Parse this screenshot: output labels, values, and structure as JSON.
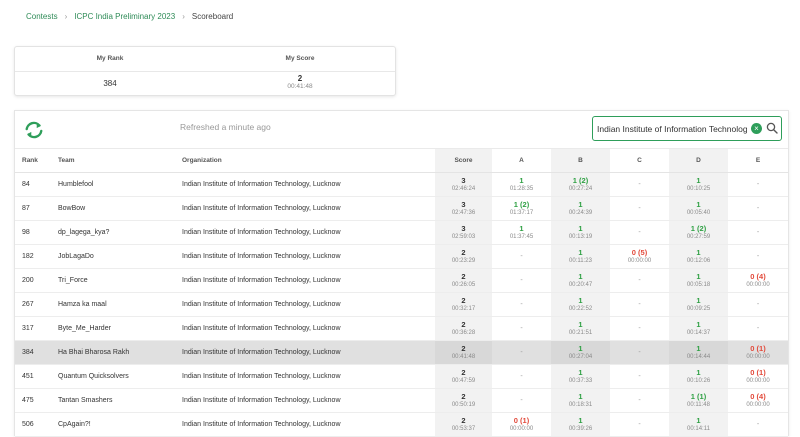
{
  "breadcrumb": {
    "items": [
      "Contests",
      "ICPC India Preliminary 2023"
    ],
    "current": "Scoreboard",
    "separator": "›"
  },
  "my_card": {
    "rank_label": "My Rank",
    "score_label": "My Score",
    "rank_value": "384",
    "score_value": "2",
    "score_time": "00:41:48"
  },
  "toolbar": {
    "refreshed_text": "Refreshed a minute ago",
    "search_value": "Indian Institute of Information Technology",
    "clear_label": "×"
  },
  "table": {
    "columns": {
      "rank": "Rank",
      "team": "Team",
      "org": "Organization",
      "score": "Score",
      "problems": [
        "A",
        "B",
        "C",
        "D",
        "E"
      ]
    },
    "highlight_rank": "384",
    "rows": [
      {
        "rank": "84",
        "team": "Humblefool",
        "org": "Indian Institute of Information Technology, Lucknow",
        "score": "3",
        "time": "02:46:24",
        "p": [
          {
            "s": "1",
            "t": "01:28:35",
            "st": "ok"
          },
          {
            "s": "1 (2)",
            "t": "00:27:24",
            "st": "ok"
          },
          {
            "s": "-",
            "t": "",
            "st": "none"
          },
          {
            "s": "1",
            "t": "00:10:25",
            "st": "ok"
          },
          {
            "s": "-",
            "t": "",
            "st": "none"
          }
        ]
      },
      {
        "rank": "87",
        "team": "BowBow",
        "org": "Indian Institute of Information Technology, Lucknow",
        "score": "3",
        "time": "02:47:36",
        "p": [
          {
            "s": "1 (2)",
            "t": "01:37:17",
            "st": "ok"
          },
          {
            "s": "1",
            "t": "00:24:39",
            "st": "ok"
          },
          {
            "s": "-",
            "t": "",
            "st": "none"
          },
          {
            "s": "1",
            "t": "00:05:40",
            "st": "ok"
          },
          {
            "s": "-",
            "t": "",
            "st": "none"
          }
        ]
      },
      {
        "rank": "98",
        "team": "dp_lagega_kya?",
        "org": "Indian Institute of Information Technology, Lucknow",
        "score": "3",
        "time": "02:59:03",
        "p": [
          {
            "s": "1",
            "t": "01:37:45",
            "st": "ok"
          },
          {
            "s": "1",
            "t": "00:13:19",
            "st": "ok"
          },
          {
            "s": "-",
            "t": "",
            "st": "none"
          },
          {
            "s": "1 (2)",
            "t": "00:27:59",
            "st": "ok"
          },
          {
            "s": "-",
            "t": "",
            "st": "none"
          }
        ]
      },
      {
        "rank": "182",
        "team": "JobLagaDo",
        "org": "Indian Institute of Information Technology, Lucknow",
        "score": "2",
        "time": "00:23:29",
        "p": [
          {
            "s": "-",
            "t": "",
            "st": "none"
          },
          {
            "s": "1",
            "t": "00:11:23",
            "st": "ok"
          },
          {
            "s": "0 (5)",
            "t": "00:00:00",
            "st": "fail"
          },
          {
            "s": "1",
            "t": "00:12:06",
            "st": "ok"
          },
          {
            "s": "-",
            "t": "",
            "st": "none"
          }
        ]
      },
      {
        "rank": "200",
        "team": "Tri_Force",
        "org": "Indian Institute of Information Technology, Lucknow",
        "score": "2",
        "time": "00:26:05",
        "p": [
          {
            "s": "-",
            "t": "",
            "st": "none"
          },
          {
            "s": "1",
            "t": "00:20:47",
            "st": "ok"
          },
          {
            "s": "-",
            "t": "",
            "st": "none"
          },
          {
            "s": "1",
            "t": "00:05:18",
            "st": "ok"
          },
          {
            "s": "0 (4)",
            "t": "00:00:00",
            "st": "fail"
          }
        ]
      },
      {
        "rank": "267",
        "team": "Hamza ka maal",
        "org": "Indian Institute of Information Technology, Lucknow",
        "score": "2",
        "time": "00:32:17",
        "p": [
          {
            "s": "-",
            "t": "",
            "st": "none"
          },
          {
            "s": "1",
            "t": "00:22:52",
            "st": "ok"
          },
          {
            "s": "-",
            "t": "",
            "st": "none"
          },
          {
            "s": "1",
            "t": "00:09:25",
            "st": "ok"
          },
          {
            "s": "-",
            "t": "",
            "st": "none"
          }
        ]
      },
      {
        "rank": "317",
        "team": "Byte_Me_Harder",
        "org": "Indian Institute of Information Technology, Lucknow",
        "score": "2",
        "time": "00:36:28",
        "p": [
          {
            "s": "-",
            "t": "",
            "st": "none"
          },
          {
            "s": "1",
            "t": "00:21:51",
            "st": "ok"
          },
          {
            "s": "-",
            "t": "",
            "st": "none"
          },
          {
            "s": "1",
            "t": "00:14:37",
            "st": "ok"
          },
          {
            "s": "-",
            "t": "",
            "st": "none"
          }
        ]
      },
      {
        "rank": "384",
        "team": "Ha Bhai Bharosa Rakh",
        "org": "Indian Institute of Information Technology, Lucknow",
        "score": "2",
        "time": "00:41:48",
        "p": [
          {
            "s": "-",
            "t": "",
            "st": "none"
          },
          {
            "s": "1",
            "t": "00:27:04",
            "st": "ok"
          },
          {
            "s": "-",
            "t": "",
            "st": "none"
          },
          {
            "s": "1",
            "t": "00:14:44",
            "st": "ok"
          },
          {
            "s": "0 (1)",
            "t": "00:00:00",
            "st": "fail"
          }
        ]
      },
      {
        "rank": "451",
        "team": "Quantum Quicksolvers",
        "org": "Indian Institute of Information Technology, Lucknow",
        "score": "2",
        "time": "00:47:59",
        "p": [
          {
            "s": "-",
            "t": "",
            "st": "none"
          },
          {
            "s": "1",
            "t": "00:37:33",
            "st": "ok"
          },
          {
            "s": "-",
            "t": "",
            "st": "none"
          },
          {
            "s": "1",
            "t": "00:10:26",
            "st": "ok"
          },
          {
            "s": "0 (1)",
            "t": "00:00:00",
            "st": "fail"
          }
        ]
      },
      {
        "rank": "475",
        "team": "Tantan Smashers",
        "org": "Indian Institute of Information Technology, Lucknow",
        "score": "2",
        "time": "00:50:19",
        "p": [
          {
            "s": "-",
            "t": "",
            "st": "none"
          },
          {
            "s": "1",
            "t": "00:18:31",
            "st": "ok"
          },
          {
            "s": "-",
            "t": "",
            "st": "none"
          },
          {
            "s": "1 (1)",
            "t": "00:11:48",
            "st": "ok"
          },
          {
            "s": "0 (4)",
            "t": "00:00:00",
            "st": "fail"
          }
        ]
      },
      {
        "rank": "506",
        "team": "CpAgain?!",
        "org": "Indian Institute of Information Technology, Lucknow",
        "score": "2",
        "time": "00:53:37",
        "p": [
          {
            "s": "0 (1)",
            "t": "00:00:00",
            "st": "fail"
          },
          {
            "s": "1",
            "t": "00:39:26",
            "st": "ok"
          },
          {
            "s": "-",
            "t": "",
            "st": "none"
          },
          {
            "s": "1",
            "t": "00:14:11",
            "st": "ok"
          },
          {
            "s": "-",
            "t": "",
            "st": "none"
          }
        ]
      }
    ]
  }
}
